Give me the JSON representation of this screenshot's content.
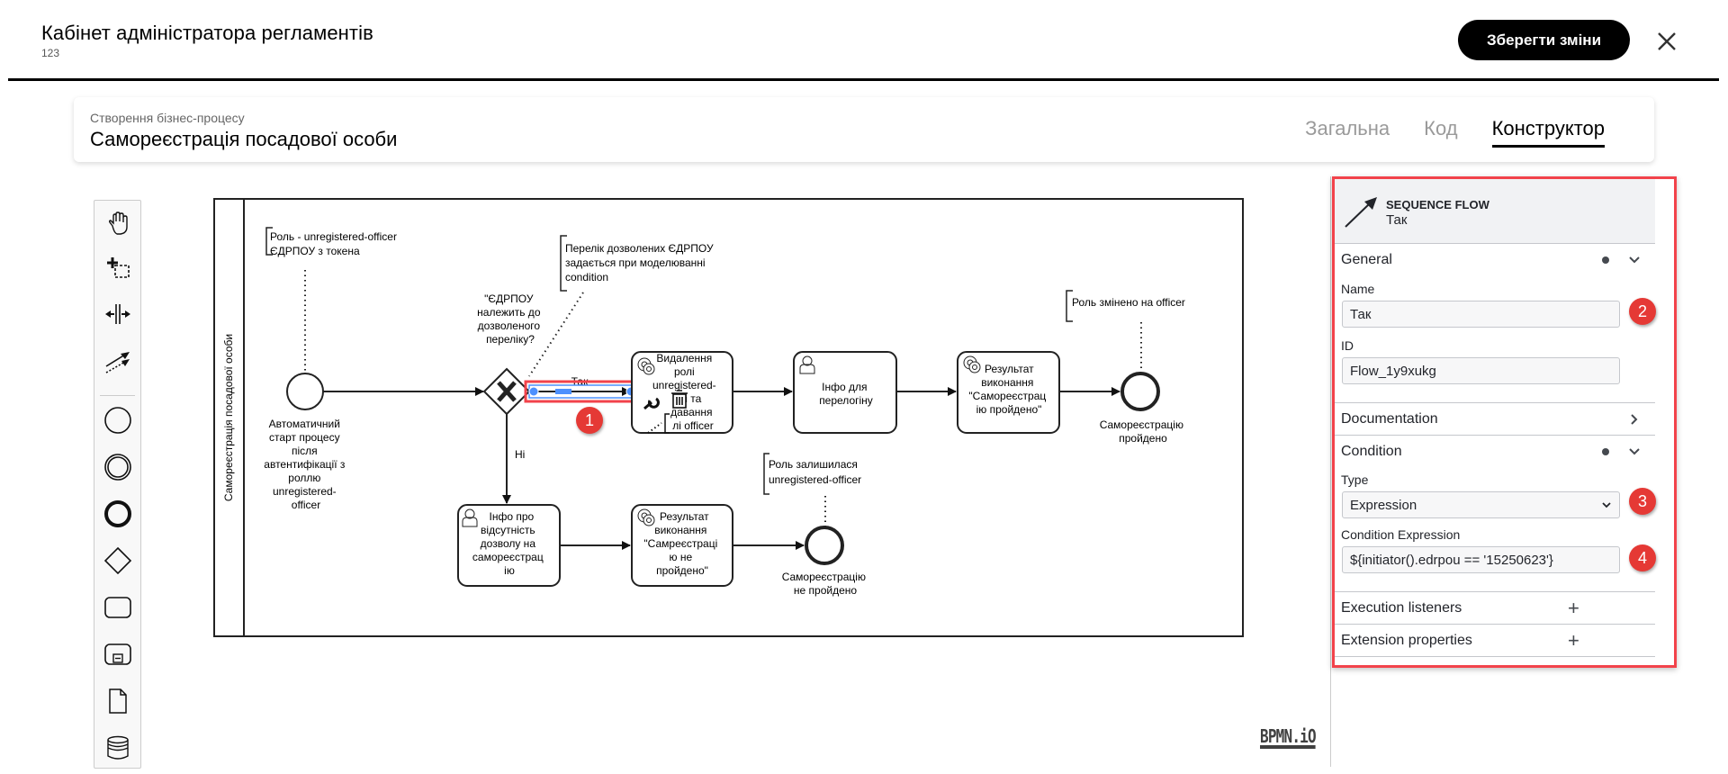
{
  "header": {
    "title": "Кабінет адміністратора регламентів",
    "subtitle": "123",
    "save_label": "Зберегти зміни",
    "close_icon": "close-icon"
  },
  "process_card": {
    "subtitle": "Створення бізнес-процесу",
    "title": "Самореєстрація посадової особи",
    "tabs": [
      {
        "label": "Загальна",
        "active": false
      },
      {
        "label": "Код",
        "active": false
      },
      {
        "label": "Конструктор",
        "active": true
      }
    ]
  },
  "palette": {
    "tools": [
      {
        "name": "hand-tool",
        "icon": "hand-icon"
      },
      {
        "name": "lasso-tool",
        "icon": "lasso-icon"
      },
      {
        "name": "space-tool",
        "icon": "space-icon"
      },
      {
        "name": "global-connect-tool",
        "icon": "connect-icon"
      },
      {
        "name": "start-event",
        "icon": "start-event-icon"
      },
      {
        "name": "intermediate-event",
        "icon": "intermediate-event-icon"
      },
      {
        "name": "end-event",
        "icon": "end-event-icon"
      },
      {
        "name": "gateway",
        "icon": "gateway-icon"
      },
      {
        "name": "task",
        "icon": "task-icon"
      },
      {
        "name": "subprocess",
        "icon": "subprocess-icon"
      },
      {
        "name": "data-object",
        "icon": "data-object-icon"
      },
      {
        "name": "data-store",
        "icon": "data-store-icon"
      }
    ]
  },
  "diagram": {
    "lane_label": "Самореєстрація посадової особи",
    "start_event_label": [
      "Автоматичний",
      "старт процесу",
      "після",
      "автентифікації з",
      "роллю",
      "unregistered-",
      "officer"
    ],
    "annotation_role": [
      "Роль - unregistered-officer",
      "ЄДРПОУ з токена"
    ],
    "annotation_list": [
      "Перелік дозволених ЄДРПОУ",
      "задається при моделюванні",
      "condition"
    ],
    "gateway_label": [
      "\"ЄДРПОУ",
      "належить до",
      "дозволеного",
      "переліку?"
    ],
    "flow_yes_label": "Так",
    "flow_no_label": "Ні",
    "task_remove_role": [
      "Видалення",
      "ролі",
      "unregistered-",
      "і та",
      "давання",
      "лі officer"
    ],
    "task_info_relogin": [
      "Інфо для",
      "перелогіну"
    ],
    "task_result_success": [
      "Результат",
      "виконання",
      "\"Самореєстрац",
      "ію пройдено\""
    ],
    "end_success_label": [
      "Самореєстрацію",
      "пройдено"
    ],
    "annotation_officer": [
      "Роль змінено на officer"
    ],
    "task_info_no_permission": [
      "Інфо про",
      "відсутність",
      "дозволу на",
      "самореєстрац",
      "ію"
    ],
    "task_result_fail": [
      "Результат",
      "виконання",
      "\"Самреєстраці",
      "ю не",
      "пройдено\""
    ],
    "end_fail_label": [
      "Самореєстрацію",
      "не пройдено"
    ],
    "annotation_unregistered": [
      "Роль залишилася",
      "unregistered-officer"
    ],
    "badge_1": "1",
    "logo": "BPMN.iO"
  },
  "properties": {
    "element_type": "SEQUENCE FLOW",
    "element_name": "Так",
    "groups": {
      "general": {
        "title": "General",
        "name_label": "Name",
        "name_value": "Так",
        "id_label": "ID",
        "id_value": "Flow_1y9xukg"
      },
      "documentation": {
        "title": "Documentation"
      },
      "condition": {
        "title": "Condition",
        "type_label": "Type",
        "type_value": "Expression",
        "expr_label": "Condition Expression",
        "expr_value": "${initiator().edrpou == '15250623'}"
      },
      "execution_listeners": {
        "title": "Execution listeners"
      },
      "extension_properties": {
        "title": "Extension properties"
      }
    },
    "badges": [
      "2",
      "3",
      "4"
    ]
  },
  "colors": {
    "selection_blue": "#4d90fe",
    "highlight_red": "#f2434b",
    "badge_red": "#e53935"
  }
}
